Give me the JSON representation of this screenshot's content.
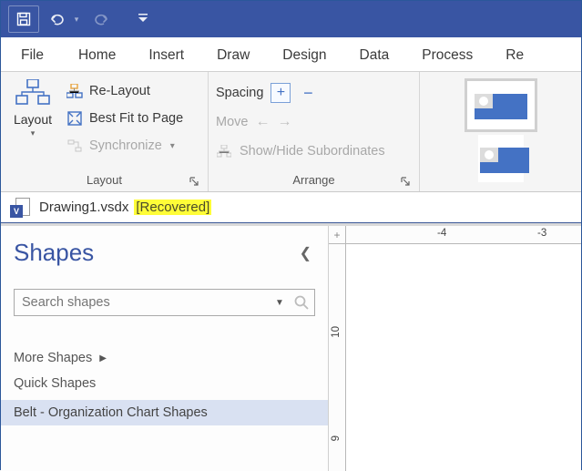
{
  "titlebar": {
    "save_icon": "save",
    "undo_icon": "undo",
    "redo_icon": "redo",
    "customize_icon": "customize"
  },
  "tabs": {
    "file": "File",
    "home": "Home",
    "insert": "Insert",
    "draw": "Draw",
    "design": "Design",
    "data": "Data",
    "process": "Process",
    "review": "Re"
  },
  "ribbon": {
    "layout": {
      "button_label": "Layout",
      "relayout": "Re-Layout",
      "bestfit": "Best Fit to Page",
      "synchronize": "Synchronize",
      "group_title": "Layout"
    },
    "arrange": {
      "spacing": "Spacing",
      "move": "Move",
      "showhide": "Show/Hide Subordinates",
      "group_title": "Arrange"
    }
  },
  "document": {
    "filename": "Drawing1.vsdx",
    "recovered": "[Recovered]",
    "app_badge": "V"
  },
  "shapes": {
    "title": "Shapes",
    "search_placeholder": "Search shapes",
    "more": "More Shapes",
    "quick": "Quick Shapes",
    "selected_stencil": "Belt - Organization Chart Shapes"
  },
  "ruler": {
    "h_minus4": "-4",
    "h_minus3": "-3",
    "v_10": "10",
    "v_9": "9"
  }
}
